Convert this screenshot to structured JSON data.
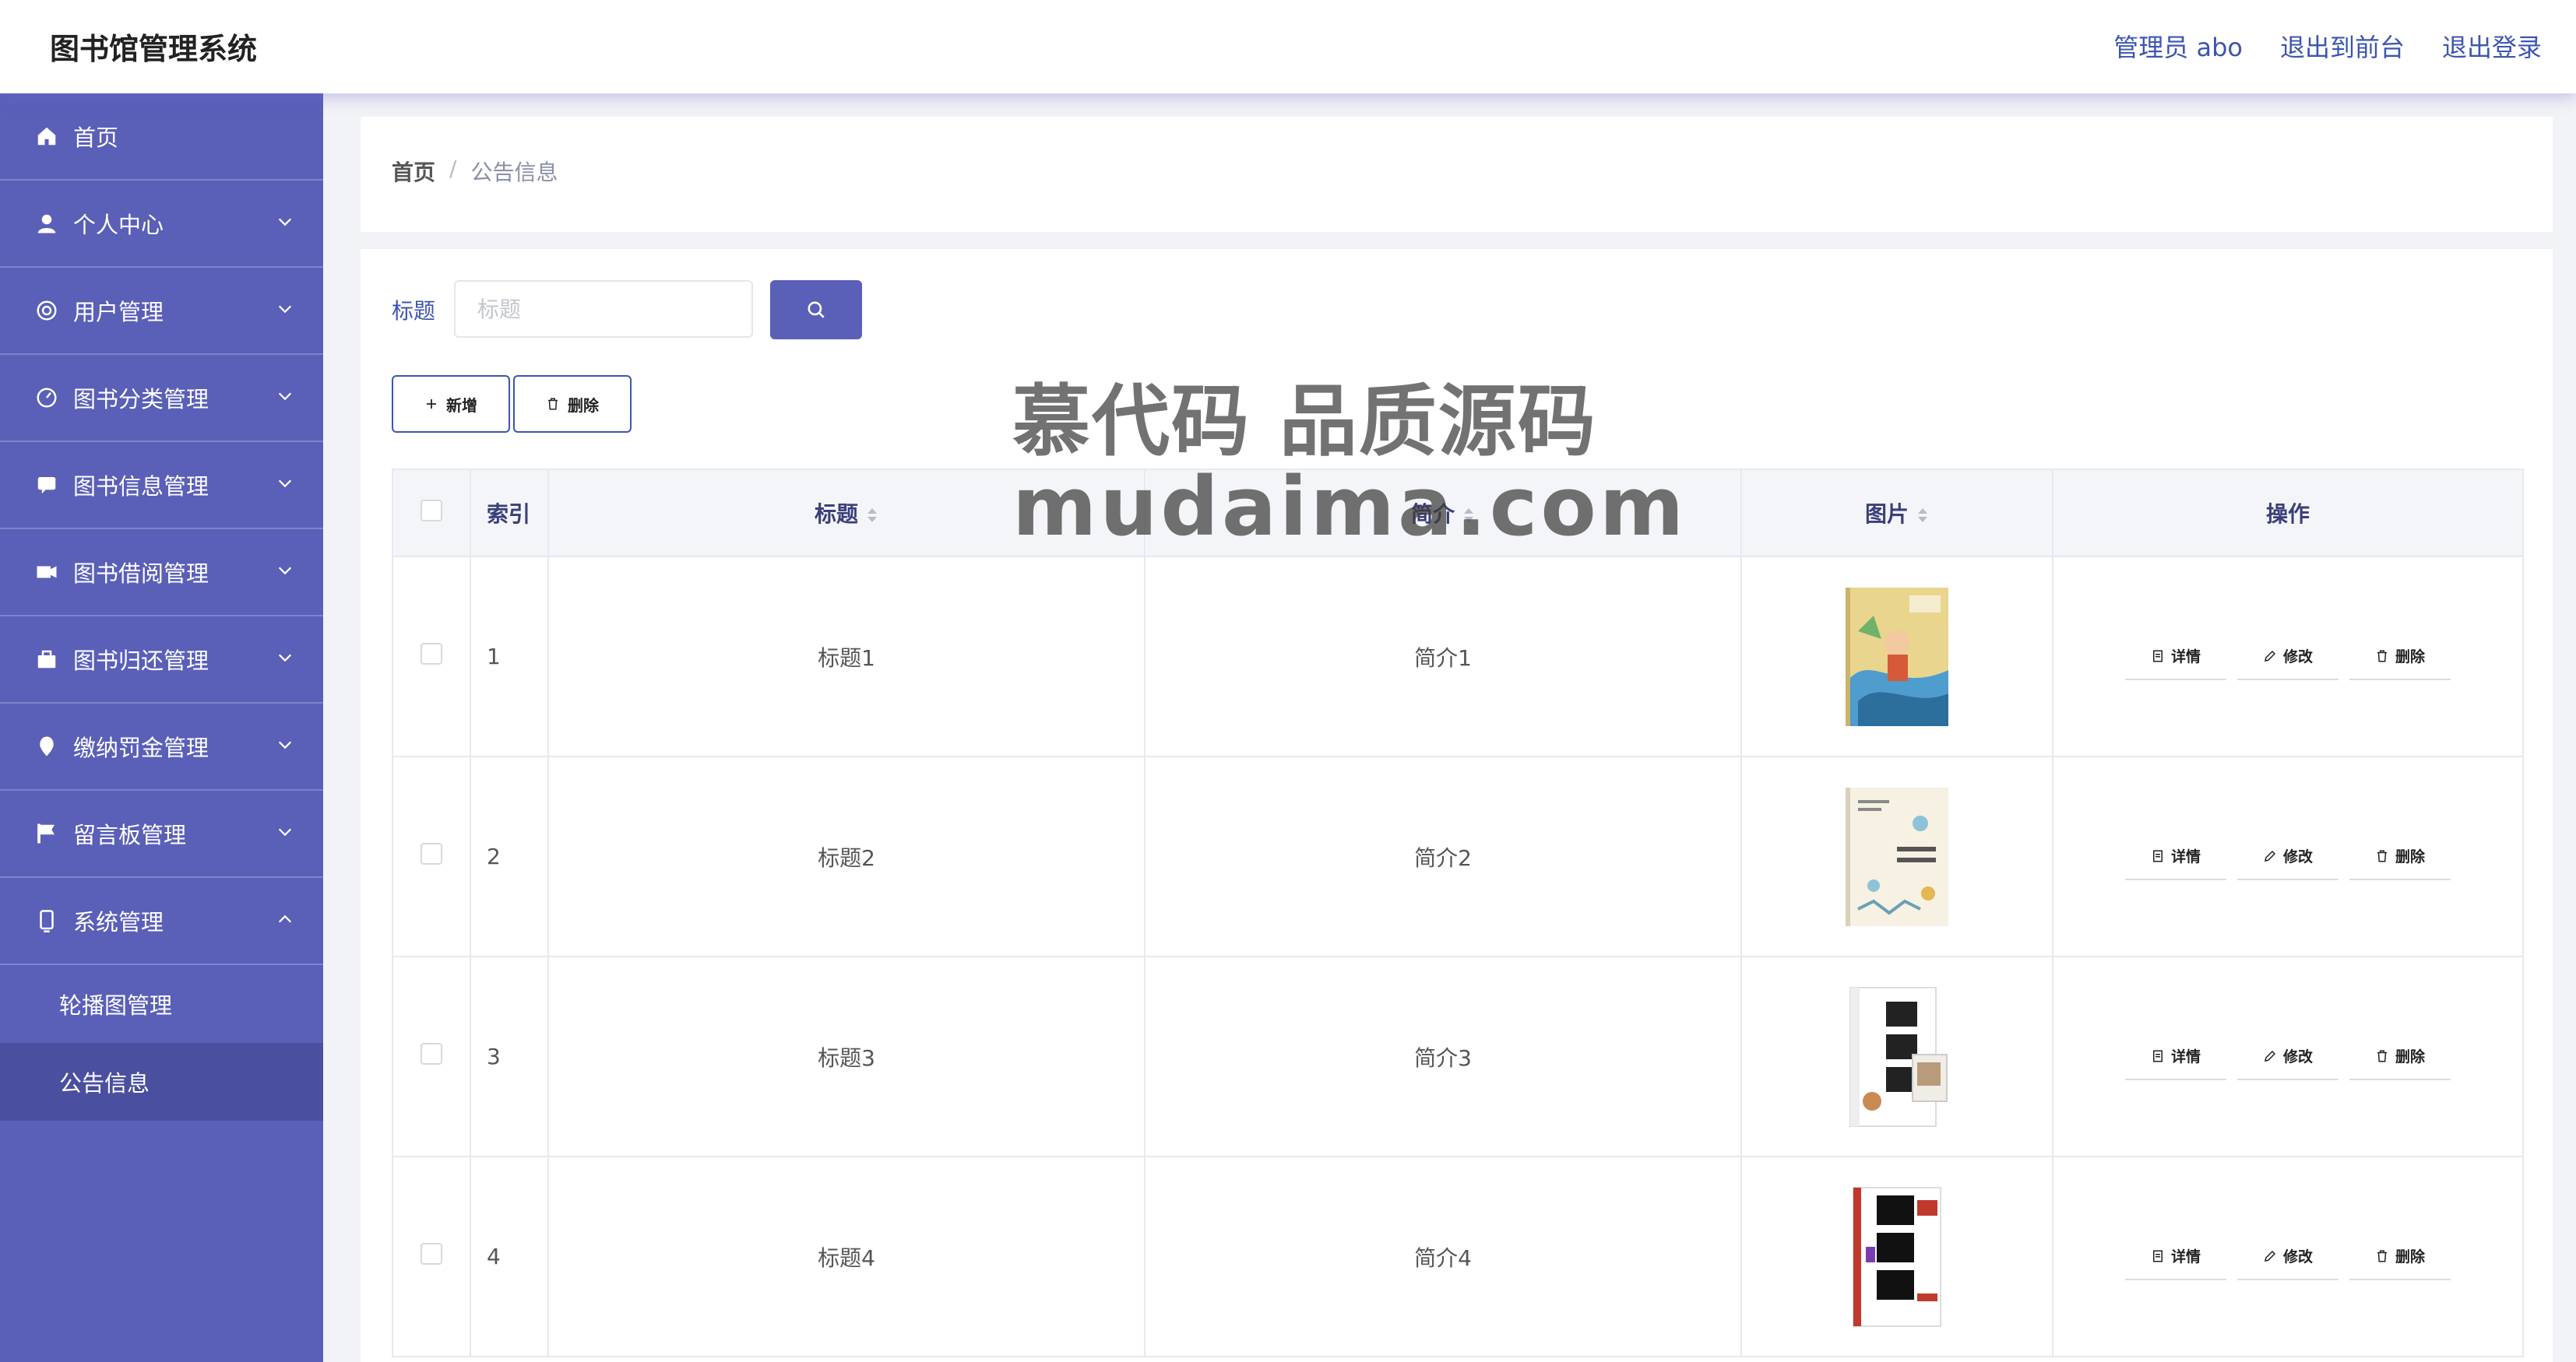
{
  "header": {
    "title": "图书馆管理系统",
    "user": "管理员 abo",
    "to_front": "退出到前台",
    "logout": "退出登录"
  },
  "sidebar": {
    "items": [
      {
        "label": "首页",
        "icon": "home-icon",
        "chevron": false
      },
      {
        "label": "个人中心",
        "icon": "user-icon",
        "chevron": true
      },
      {
        "label": "用户管理",
        "icon": "users-icon",
        "chevron": true
      },
      {
        "label": "图书分类管理",
        "icon": "category-icon",
        "chevron": true
      },
      {
        "label": "图书信息管理",
        "icon": "book-icon",
        "chevron": true
      },
      {
        "label": "图书借阅管理",
        "icon": "borrow-icon",
        "chevron": true
      },
      {
        "label": "图书归还管理",
        "icon": "return-icon",
        "chevron": true
      },
      {
        "label": "缴纳罚金管理",
        "icon": "fine-icon",
        "chevron": true
      },
      {
        "label": "留言板管理",
        "icon": "message-icon",
        "chevron": true
      },
      {
        "label": "系统管理",
        "icon": "system-icon",
        "chevron": true,
        "expanded": true
      }
    ],
    "sub_items": [
      {
        "label": "轮播图管理",
        "active": false
      },
      {
        "label": "公告信息",
        "active": true
      }
    ]
  },
  "breadcrumb": {
    "home": "首页",
    "separator": "/",
    "current": "公告信息"
  },
  "filter": {
    "label": "标题",
    "placeholder": "标题",
    "value": ""
  },
  "actions": {
    "add": "新增",
    "delete": "删除"
  },
  "table": {
    "headers": {
      "index": "索引",
      "title": "标题",
      "intro": "简介",
      "image": "图片",
      "ops": "操作"
    },
    "rows": [
      {
        "index": "1",
        "title": "标题1",
        "intro": "简介1",
        "cover": "book-cover-1"
      },
      {
        "index": "2",
        "title": "标题2",
        "intro": "简介2",
        "cover": "book-cover-2"
      },
      {
        "index": "3",
        "title": "标题3",
        "intro": "简介3",
        "cover": "book-cover-3"
      },
      {
        "index": "4",
        "title": "标题4",
        "intro": "简介4",
        "cover": "book-cover-4"
      }
    ],
    "row_ops": {
      "detail": "详情",
      "edit": "修改",
      "delete": "删除"
    }
  },
  "watermark": {
    "line1": "慕代码 品质源码",
    "line2": "mudaima.com"
  },
  "colors": {
    "sidebar": "#5a5fb8",
    "accent": "#3c55b0",
    "active_sub": "#4a4f9f"
  }
}
